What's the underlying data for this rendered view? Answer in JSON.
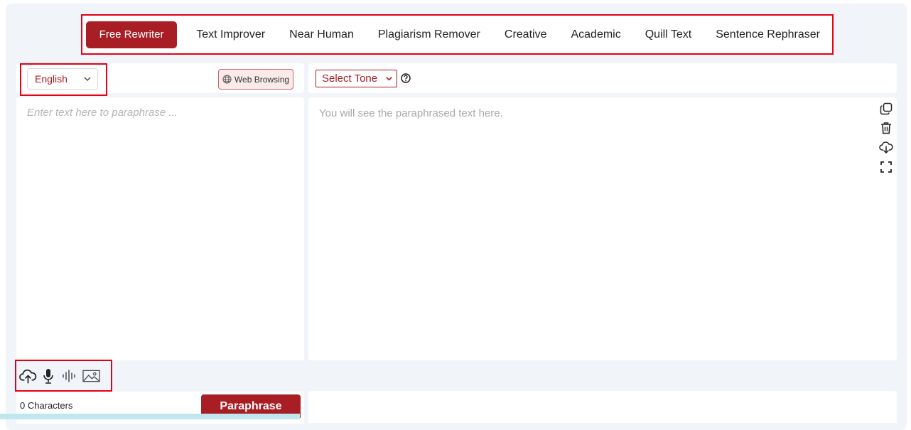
{
  "modes": [
    {
      "label": "Free Rewriter",
      "active": true
    },
    {
      "label": "Text Improver",
      "active": false
    },
    {
      "label": "Near Human",
      "active": false
    },
    {
      "label": "Plagiarism Remover",
      "active": false
    },
    {
      "label": "Creative",
      "active": false
    },
    {
      "label": "Academic",
      "active": false
    },
    {
      "label": "Quill Text",
      "active": false
    },
    {
      "label": "Sentence Rephraser",
      "active": false
    }
  ],
  "input": {
    "language": "English",
    "web_browsing_label": "Web Browsing",
    "placeholder": "Enter text here to paraphrase ...",
    "value": "",
    "char_count": "0 Characters",
    "paraphrase_label": "Paraphrase",
    "tools": [
      "upload-cloud-icon",
      "microphone-icon",
      "audio-wave-icon",
      "image-icon"
    ]
  },
  "output": {
    "tone_select": "Select Tone",
    "placeholder_text": "You will see the paraphrased text here.",
    "actions": [
      "copy-icon",
      "trash-icon",
      "download-cloud-icon",
      "fullscreen-icon"
    ]
  },
  "colors": {
    "accent": "#a81e24",
    "highlight_box": "#e60012",
    "background": "#f1f4f8"
  }
}
